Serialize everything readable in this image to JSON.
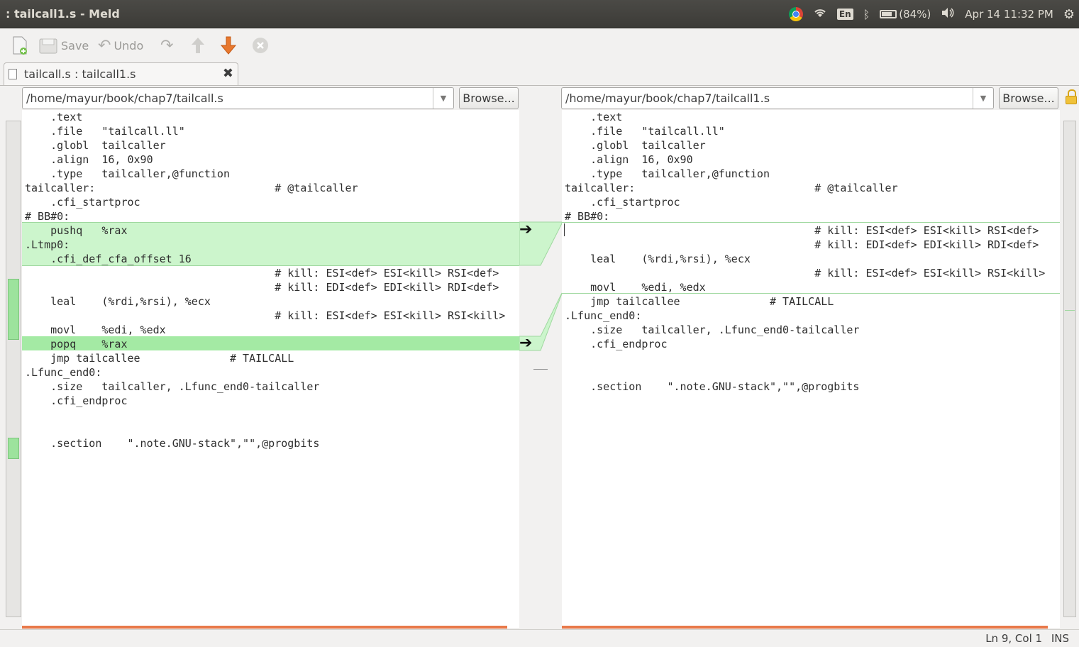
{
  "window": {
    "title": ": tailcall1.s - Meld"
  },
  "tray": {
    "keyboard": "En",
    "battery": "(84%)",
    "datetime": "Apr 14 11:32 PM"
  },
  "toolbar": {
    "save_label": "Save",
    "undo_label": "Undo"
  },
  "tab": {
    "label": "tailcall.s : tailcall1.s"
  },
  "left_pane": {
    "path": "/home/mayur/book/chap7/tailcall.s",
    "browse_label": "Browse...",
    "lines": [
      "    .text",
      "    .file   \"tailcall.ll\"",
      "    .globl  tailcaller",
      "    .align  16, 0x90",
      "    .type   tailcaller,@function",
      "tailcaller:                            # @tailcaller",
      "    .cfi_startproc",
      "# BB#0:",
      "    pushq   %rax",
      ".Ltmp0:",
      "    .cfi_def_cfa_offset 16",
      "                                       # kill: ESI<def> ESI<kill> RSI<def>",
      "                                       # kill: EDI<def> EDI<kill> RDI<def>",
      "    leal    (%rdi,%rsi), %ecx",
      "                                       # kill: ESI<def> ESI<kill> RSI<kill>",
      "    movl    %edi, %edx",
      "    popq    %rax",
      "    jmp tailcallee              # TAILCALL",
      ".Lfunc_end0:",
      "    .size   tailcaller, .Lfunc_end0-tailcaller",
      "    .cfi_endproc",
      "",
      "",
      "    .section    \".note.GNU-stack\",\"\",@progbits"
    ]
  },
  "right_pane": {
    "path": "/home/mayur/book/chap7/tailcall1.s",
    "browse_label": "Browse...",
    "lines": [
      "    .text",
      "    .file   \"tailcall.ll\"",
      "    .globl  tailcaller",
      "    .align  16, 0x90",
      "    .type   tailcaller,@function",
      "tailcaller:                            # @tailcaller",
      "    .cfi_startproc",
      "# BB#0:",
      "                                       # kill: ESI<def> ESI<kill> RSI<def>",
      "                                       # kill: EDI<def> EDI<kill> RDI<def>",
      "    leal    (%rdi,%rsi), %ecx",
      "                                       # kill: ESI<def> ESI<kill> RSI<kill>",
      "    movl    %edi, %edx",
      "    jmp tailcallee              # TAILCALL",
      ".Lfunc_end0:",
      "    .size   tailcaller, .Lfunc_end0-tailcaller",
      "    .cfi_endproc",
      "",
      "",
      "    .section    \".note.GNU-stack\",\"\",@progbits"
    ]
  },
  "status": {
    "position": "Ln 9, Col 1",
    "mode": "INS"
  },
  "colors": {
    "insert_chunk": "#ccf5cc",
    "insert_chunk_strong": "#a4eaa4",
    "scroll_marker": "#e8794a"
  }
}
